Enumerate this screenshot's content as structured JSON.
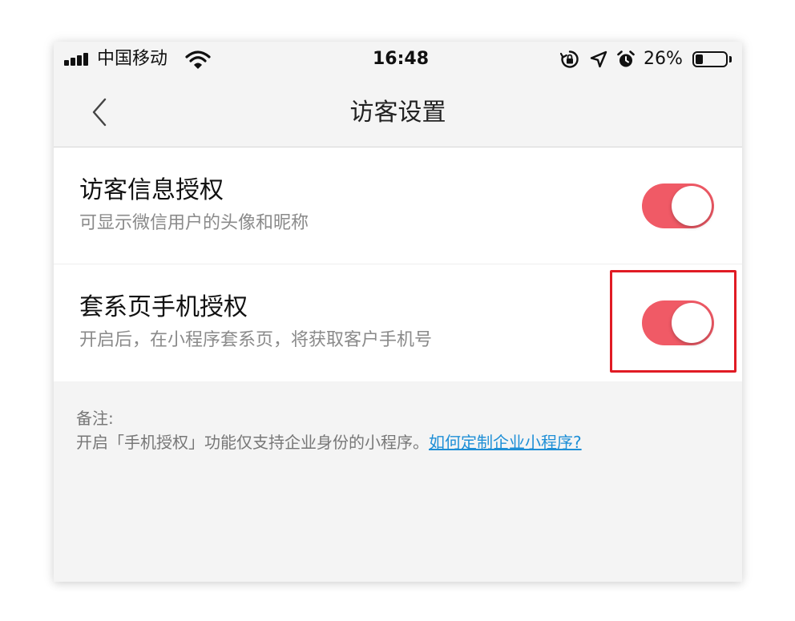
{
  "status_bar": {
    "carrier": "中国移动",
    "time": "16:48",
    "battery_percent": "26%",
    "battery_level": 0.26,
    "icons": [
      "signal-icon",
      "wifi-icon",
      "rotation-lock-icon",
      "location-icon",
      "alarm-icon",
      "battery-icon"
    ]
  },
  "nav": {
    "title": "访客设置",
    "back_icon": "chevron-left-icon"
  },
  "settings": [
    {
      "title": "访客信息授权",
      "description": "可显示微信用户的头像和昵称",
      "enabled": true
    },
    {
      "title": "套系页手机授权",
      "description": "开启后，在小程序套系页，将获取客户手机号",
      "enabled": true,
      "highlighted": true
    }
  ],
  "note": {
    "label": "备注:",
    "text": "开启「手机授权」功能仅支持企业身份的小程序。",
    "link": "如何定制企业小程序?"
  },
  "colors": {
    "toggle_on": "#f05a66",
    "highlight": "#e01b24",
    "link": "#1f8fd6",
    "background": "#f4f4f4"
  }
}
